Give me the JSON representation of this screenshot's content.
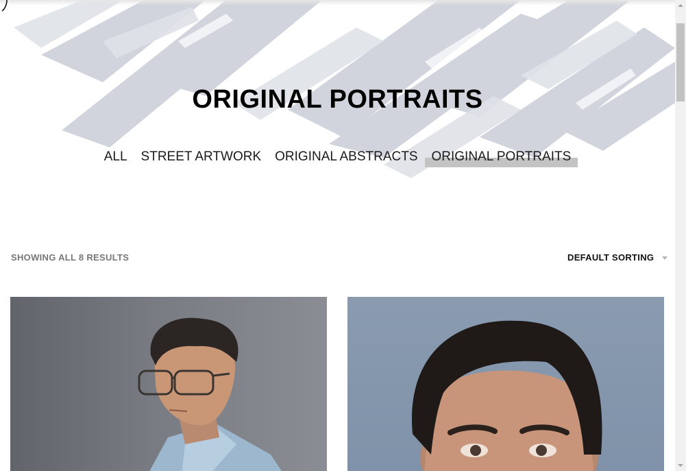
{
  "page": {
    "title": "ORIGINAL PORTRAITS"
  },
  "category_nav": {
    "items": [
      {
        "label": "ALL",
        "active": false
      },
      {
        "label": "STREET ARTWORK",
        "active": false
      },
      {
        "label": "ORIGINAL ABSTRACTS",
        "active": false
      },
      {
        "label": "ORIGINAL PORTRAITS",
        "active": true
      }
    ]
  },
  "shop_toolbar": {
    "results_text": "SHOWING ALL 8 RESULTS",
    "sort_selected": "DEFAULT SORTING"
  },
  "colors": {
    "brush_stroke": "#c8ccd6",
    "active_highlight": "#c3c3c3",
    "muted_text": "#777777"
  },
  "products": [
    {
      "image": "portrait-man-with-glasses"
    },
    {
      "image": "portrait-man-close-up"
    }
  ]
}
